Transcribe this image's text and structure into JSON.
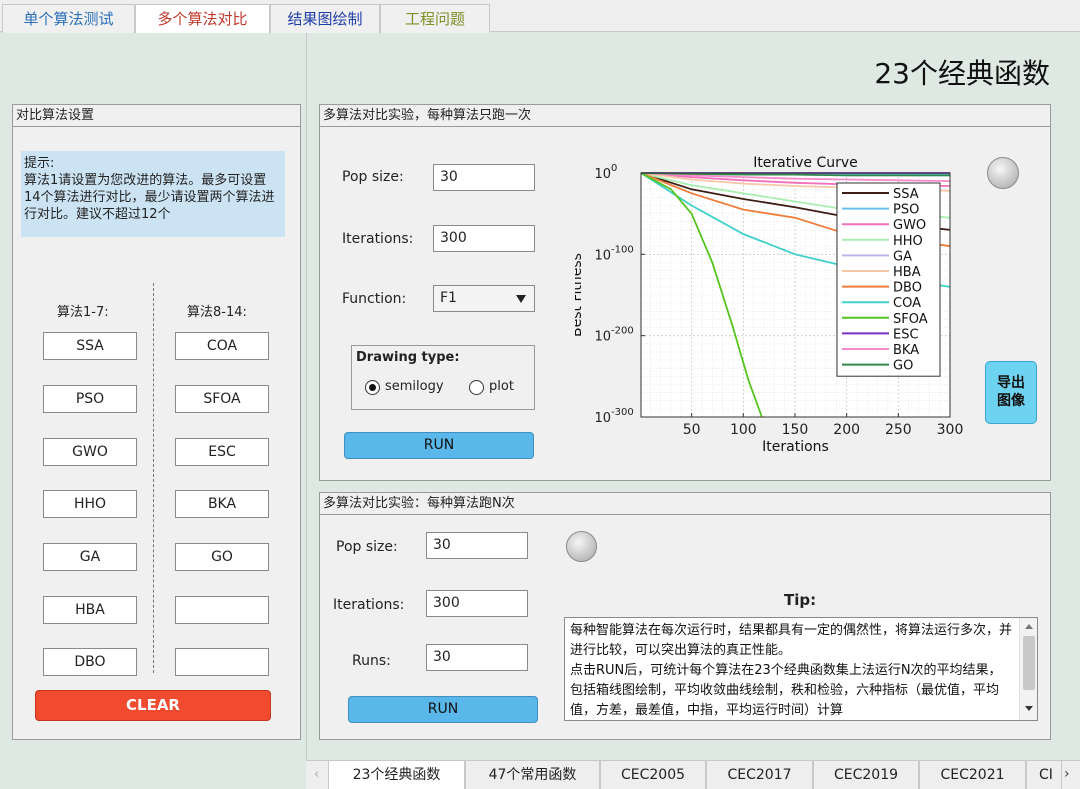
{
  "top_tabs": [
    {
      "label": "单个算法测试",
      "color": "#2a6fb8"
    },
    {
      "label": "多个算法对比",
      "color": "#c0392b"
    },
    {
      "label": "结果图绘制",
      "color": "#1f3fa8"
    },
    {
      "label": "工程问题",
      "color": "#7f8f28"
    }
  ],
  "page_title": "23个经典函数",
  "left_panel": {
    "title": "对比算法设置",
    "hint": "提示:\n算法1请设置为您改进的算法。最多可设置14个算法进行对比，最少请设置两个算法进行对比。建议不超过12个",
    "col1_header": "算法1-7:",
    "col2_header": "算法8-14:",
    "col1": [
      "SSA",
      "PSO",
      "GWO",
      "HHO",
      "GA",
      "HBA",
      "DBO"
    ],
    "col2": [
      "COA",
      "SFOA",
      "ESC",
      "BKA",
      "GO",
      "",
      ""
    ],
    "clear_label": "CLEAR"
  },
  "single_run": {
    "title": "多算法对比实验，每种算法只跑一次",
    "pop_label": "Pop size:",
    "pop_value": "30",
    "iter_label": "Iterations:",
    "iter_value": "300",
    "func_label": "Function:",
    "func_value": "F1",
    "dropdown_icon": "triangle-down",
    "drawing_type_title": "Drawing type:",
    "radio_semilogy": "semilogy",
    "radio_plot": "plot",
    "run_label": "RUN",
    "export_label": "导出\n图像"
  },
  "multi_run": {
    "title": "多算法对比实验：每种算法跑N次",
    "pop_label": "Pop size:",
    "pop_value": "30",
    "iter_label": "Iterations:",
    "iter_value": "300",
    "runs_label": "Runs:",
    "runs_value": "30",
    "run_label": "RUN",
    "tip_title": "Tip:",
    "tip_text": "每种智能算法在每次运行时，结果都具有一定的偶然性，将算法运行多次，并进行比较，可以突出算法的真正性能。\n点击RUN后，可统计每个算法在23个经典函数集上法运行N次的平均结果，包括箱线图绘制，平均收敛曲线绘制，秩和检验，六种指标（最优值，平均值，方差，最差值，中指，平均运行时间）计算"
  },
  "bottom_tabs": [
    "23个经典函数",
    "47个常用函数",
    "CEC2005",
    "CEC2017",
    "CEC2019",
    "CEC2021",
    "CI"
  ],
  "chart_data": {
    "type": "line",
    "title": "Iterative Curve",
    "xlabel": "Iterations",
    "ylabel": "Best Fitness",
    "xscale": "linear",
    "yscale": "log",
    "xlim": [
      1,
      300
    ],
    "ylim_exponent": [
      -300,
      0
    ],
    "xticks": [
      50,
      100,
      150,
      200,
      250,
      300
    ],
    "yticks_labels": [
      "10^0",
      "10^-100",
      "10^-200",
      "10^-300"
    ],
    "grid": true,
    "legend_position": "top-right",
    "series": [
      {
        "name": "SSA",
        "color": "#3d1d14",
        "x": [
          1,
          50,
          100,
          150,
          200,
          250,
          300
        ],
        "log10_y": [
          0,
          -20,
          -32,
          -42,
          -54,
          -63,
          -70
        ]
      },
      {
        "name": "PSO",
        "color": "#69c0e8",
        "x": [
          1,
          50,
          100,
          150,
          200,
          250,
          300
        ],
        "log10_y": [
          0,
          -1,
          -1,
          -1,
          -1,
          -1,
          -1
        ]
      },
      {
        "name": "GWO",
        "color": "#f36fbe",
        "x": [
          1,
          50,
          100,
          150,
          200,
          250,
          300
        ],
        "log10_y": [
          0,
          -5,
          -9,
          -12,
          -14,
          -15,
          -16
        ]
      },
      {
        "name": "HHO",
        "color": "#a8eeb0",
        "x": [
          1,
          50,
          100,
          150,
          200,
          250,
          300
        ],
        "log10_y": [
          0,
          -15,
          -25,
          -35,
          -45,
          -50,
          -55
        ]
      },
      {
        "name": "GA",
        "color": "#b9b6e8",
        "x": [
          1,
          50,
          100,
          150,
          200,
          250,
          300
        ],
        "log10_y": [
          0,
          -1,
          -2,
          -2,
          -3,
          -3,
          -3
        ]
      },
      {
        "name": "HBA",
        "color": "#f7c8a8",
        "x": [
          1,
          50,
          100,
          150,
          200,
          250,
          300
        ],
        "log10_y": [
          0,
          -8,
          -13,
          -16,
          -18,
          -20,
          -22
        ]
      },
      {
        "name": "DBO",
        "color": "#f07c3a",
        "x": [
          1,
          50,
          100,
          150,
          200,
          250,
          300
        ],
        "log10_y": [
          0,
          -25,
          -45,
          -55,
          -75,
          -80,
          -90
        ]
      },
      {
        "name": "COA",
        "color": "#3fd0cc",
        "x": [
          1,
          50,
          100,
          150,
          200,
          250,
          300
        ],
        "log10_y": [
          0,
          -40,
          -75,
          -100,
          -115,
          -130,
          -140
        ]
      },
      {
        "name": "SFOA",
        "color": "#55c41e",
        "x": [
          1,
          30,
          50,
          70,
          90,
          105,
          118
        ],
        "log10_y": [
          0,
          -20,
          -50,
          -110,
          -190,
          -255,
          -300
        ]
      },
      {
        "name": "ESC",
        "color": "#7a2fc4",
        "x": [
          1,
          50,
          100,
          150,
          200,
          250,
          300
        ],
        "log10_y": [
          0,
          0,
          0,
          0,
          0,
          0,
          0
        ]
      },
      {
        "name": "BKA",
        "color": "#f58acb",
        "x": [
          1,
          50,
          100,
          150,
          200,
          250,
          300
        ],
        "log10_y": [
          0,
          -3,
          -5,
          -7,
          -8,
          -9,
          -10
        ]
      },
      {
        "name": "GO",
        "color": "#2d8a4a",
        "x": [
          1,
          50,
          100,
          150,
          200,
          250,
          300
        ],
        "log10_y": [
          0,
          -1,
          -2,
          -2,
          -3,
          -3,
          -3
        ]
      }
    ]
  }
}
